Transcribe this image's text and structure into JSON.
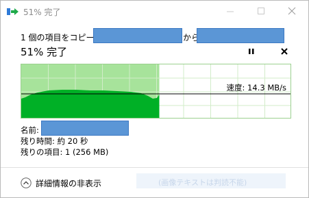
{
  "window": {
    "title": "51% 完了"
  },
  "copy": {
    "prefix": "1 個の項目をコピー中:",
    "from_label": "から"
  },
  "progress": {
    "title": "51% 完了",
    "fraction": 0.51
  },
  "graph": {
    "speed_label": "速度: 14.3 MB/s",
    "fill_color": "#00b026",
    "progress_color": "#a7e39b",
    "grid_color": "#d2ecc9"
  },
  "details": {
    "name_label": "名前:",
    "time_label": "残り時間:",
    "time_value": "約 20 秒",
    "items_label": "残りの項目:",
    "items_value": "1 (256 MB)"
  },
  "footer": {
    "toggle_label": "詳細情報の非表示",
    "faded_text": "(画像テキストは判読不能)"
  },
  "icons": {
    "app": "copy-arrow-icon",
    "pause": "pause-icon",
    "cancel": "close-icon",
    "toggle": "chevron-up-circle-icon"
  },
  "colors": {
    "redaction": "#5b96d6",
    "title_text": "#8c8c8c"
  }
}
